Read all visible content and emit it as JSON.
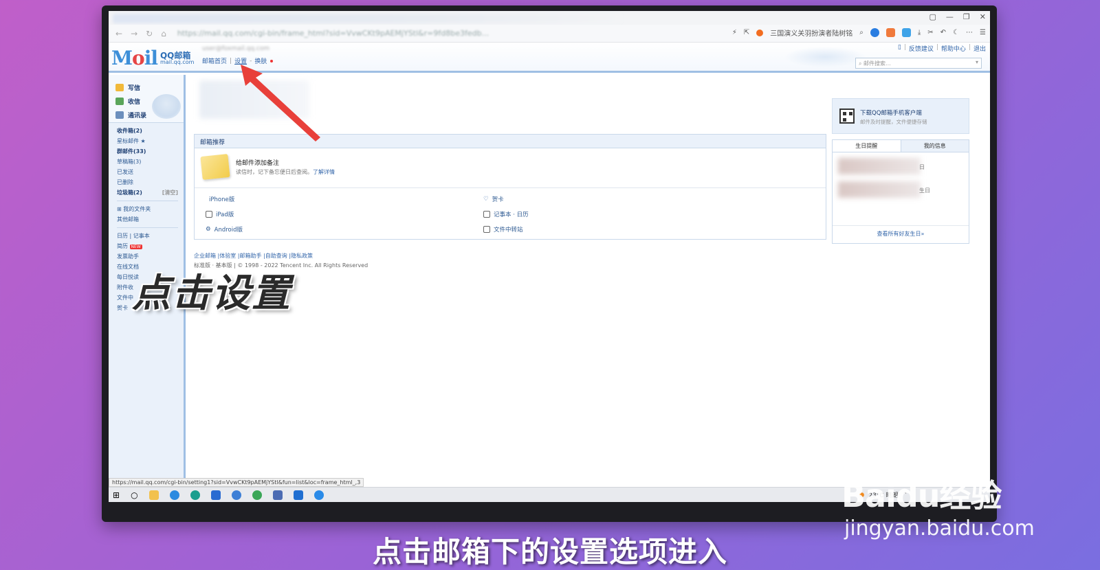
{
  "browser": {
    "url": "https://mail.qq.com/cgi-bin/frame_html?sid=VvwCKt9pAEMjYStl&r=9fd8be3fedb...",
    "toolbar_text": "三国演义关羽扮演者陆树铭",
    "window_controls": [
      "▢",
      "—",
      "❐",
      "✕"
    ]
  },
  "header": {
    "logo_main": "Mail",
    "logo_cn": "QQ邮箱",
    "logo_domain": "mail.qq.com",
    "account": "user@foxmail.qq.com",
    "links": {
      "home": "邮箱首页",
      "settings": "设置",
      "skin": "换肤"
    },
    "user_links": [
      "反馈建议",
      "帮助中心",
      "退出"
    ],
    "search_placeholder": "邮件搜索..."
  },
  "sidebar": {
    "quick": [
      "写信",
      "收信",
      "通讯录"
    ],
    "folders": [
      {
        "label": "收件箱(2)",
        "bold": true
      },
      {
        "label": "星标邮件 ★",
        "bold": false
      },
      {
        "label": "群邮件(33)",
        "bold": true
      },
      {
        "label": "草稿箱(3)",
        "bold": false
      },
      {
        "label": "已发送",
        "bold": false
      },
      {
        "label": "已删除",
        "bold": false
      },
      {
        "label": "垃圾箱(2)",
        "bold": true,
        "right": "[清空]"
      }
    ],
    "my_folders": "我的文件夹",
    "other_mail": "其他邮箱",
    "tools": [
      "日历 | 记事本",
      "简历",
      "发票助手",
      "在线文档",
      "每日悦读",
      "附件收",
      "文件中",
      "贺卡"
    ],
    "new_badge": "NEW"
  },
  "main": {
    "panel_title": "邮箱推荐",
    "note_title": "给邮件添加备注",
    "note_desc": "读信时，记下备忘便日后查阅。",
    "note_link": "了解详情",
    "apps_left": [
      "iPhone版",
      "iPad版",
      "Android版"
    ],
    "apps_right": [
      "贺卡",
      "记事本 · 日历",
      "文件中转站"
    ],
    "footer_links": "企业邮箱 |体验室 |邮箱助手 |自助查询 |隐私政策",
    "footer_copy": "标准版 · 基本版 | © 1998 - 2022 Tencent Inc. All Rights Reserved"
  },
  "right": {
    "download_title": "下载QQ邮箱手机客户端",
    "download_sub": "邮件及时提醒，文件便捷存储",
    "tab_birthday": "生日提醒",
    "tab_info": "我的信息",
    "bday_1": "日",
    "bday_2": "生日",
    "bday_link": "查看所有好友生日»"
  },
  "status_url": "https://mail.qq.com/cgi-bin/setting1?sid=VvwCKt9pAEMjYStl&fun=list&loc=frame_html_,3",
  "taskbar": {
    "weather": "23°C 晴朗"
  },
  "overlay": {
    "big_text": "点击设置",
    "caption": "点击邮箱下的设置选项进入",
    "watermark_main": "Baidu经验",
    "watermark_sub": "jingyan.baidu.com"
  },
  "colors": {
    "accent": "#3d8fd8",
    "arrow": "#e8403a",
    "border": "#9fbfe4"
  }
}
